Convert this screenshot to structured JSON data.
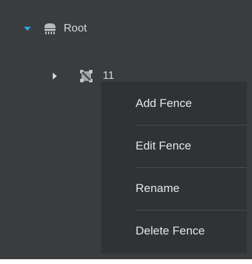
{
  "tree": {
    "root": {
      "label": "Root",
      "expanded": true,
      "icon": "server-icon",
      "caret_icon": "caret-down-icon"
    },
    "child": {
      "label": "11",
      "expanded": false,
      "icon": "fence-icon",
      "caret_icon": "caret-right-icon"
    }
  },
  "context_menu": {
    "items": [
      {
        "label": "Add Fence"
      },
      {
        "label": "Edit Fence"
      },
      {
        "label": "Rename"
      },
      {
        "label": "Delete Fence"
      }
    ]
  },
  "colors": {
    "background": "#3a3c3f",
    "menu_background": "#303235",
    "text": "#d7d9dc",
    "accent": "#2ea6ea",
    "icon": "#b7bbc0"
  }
}
